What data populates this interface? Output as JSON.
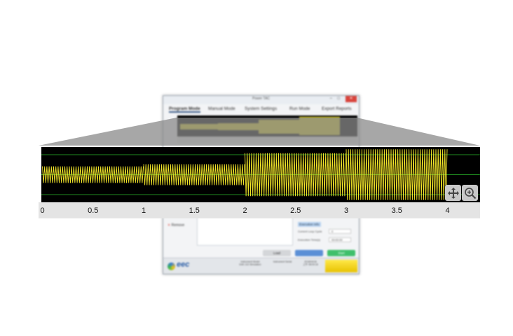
{
  "window": {
    "title": "Power TAC",
    "minimize_glyph": "–",
    "maximize_glyph": "□",
    "close_glyph": "✕"
  },
  "menu": {
    "items": [
      "Program Mode",
      "Manual Mode",
      "System Settings",
      "Run Mode",
      "Export Reports"
    ]
  },
  "left_panel": {
    "remove_label": "Remove"
  },
  "execution": {
    "title": "Execution Info",
    "loop_label": "Current Loop Cycle",
    "loop_value": "0",
    "time_label": "Execution Time(s)",
    "time_value": "00:00:00"
  },
  "buttons": {
    "load": "Load",
    "middle": "",
    "start": "Start"
  },
  "logo": {
    "text": "eec"
  },
  "status": {
    "model_label": "Instrument Model",
    "model_value": "EAK-110 Simulation",
    "serial_label": "Instrument Serial",
    "serial_value": "",
    "date_value": "2018/04/18",
    "time_value": "上午 08:00:18"
  },
  "colors": {
    "waveform": "#f5e82a",
    "plot_bg": "#000000",
    "gridline": "#1f8a1f",
    "accent": "#3b5b87"
  },
  "tools": {
    "pan": "move-arrows-icon",
    "zoom": "magnifier-plus-icon"
  },
  "chart_data": {
    "type": "line",
    "title": "",
    "xlabel": "",
    "ylabel": "",
    "xlim": [
      0,
      4.3
    ],
    "xticks": [
      "0",
      "0.5",
      "1",
      "1.5",
      "2",
      "2.5",
      "3",
      "3.5",
      "4"
    ],
    "grid": true,
    "series": [
      {
        "segments": [
          {
            "x_start": 0,
            "x_end": 1.0,
            "amplitude": 0.3
          },
          {
            "x_start": 1.0,
            "x_end": 2.0,
            "amplitude": 0.38
          },
          {
            "x_start": 2.0,
            "x_end": 3.0,
            "amplitude": 0.78
          },
          {
            "x_start": 3.0,
            "x_end": 4.0,
            "amplitude": 0.92
          }
        ]
      }
    ]
  }
}
